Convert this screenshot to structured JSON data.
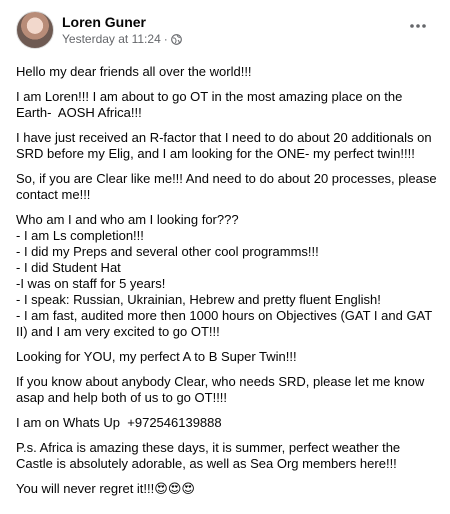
{
  "post": {
    "author": "Loren Guner",
    "timestamp": "Yesterday at 11:24",
    "separator": "·",
    "privacy_icon": "globe-icon",
    "more_icon": "more-options-icon",
    "paragraphs": [
      "Hello my dear friends all over the world!!!",
      "I am Loren!!! I am about to go OT in the most amazing place on the Earth-  AOSH Africa!!!",
      "I have just received an R-factor that I need to do about 20 additionals on SRD before my Elig, and I am looking for the ONE- my perfect twin!!!!",
      "So, if you are Clear like me!!! And need to do about 20 processes, please contact me!!!"
    ],
    "list_intro": "Who am I and who am I looking for???",
    "list_items": [
      "- I am Ls completion!!!",
      "- I did my Preps and several other cool programms!!!",
      "- I did Student Hat",
      "-I was on staff for 5 years!",
      "- I speak: Russian, Ukrainian, Hebrew and pretty fluent English!",
      "- I am fast, audited more then 1000 hours on Objectives (GAT I and GAT II) and I am very excited to go OT!!!"
    ],
    "paragraphs_after": [
      "Looking for YOU, my perfect A to B Super Twin!!!",
      "If you know about anybody Clear, who needs SRD, please let me know asap and help both of us to go OT!!!!",
      "I am on Whats Up  +972546139888",
      "P.s. Africa is amazing these days, it is summer, perfect weather the Castle is absolutely adorable, as well as Sea Org members here!!!"
    ],
    "closing": "You will never regret it!!!",
    "closing_emoji": "😍😍😍"
  }
}
